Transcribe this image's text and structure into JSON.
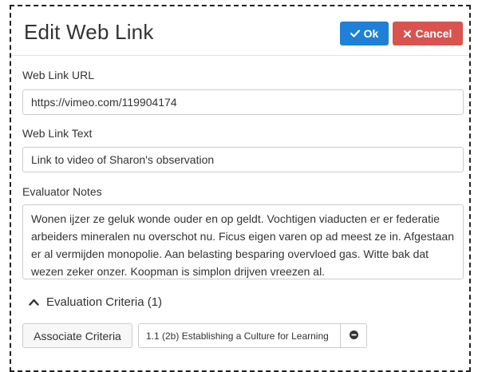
{
  "dialog": {
    "title": "Edit Web Link",
    "ok_label": "Ok",
    "cancel_label": "Cancel"
  },
  "fields": {
    "url_label": "Web Link URL",
    "url_value": "https://vimeo.com/119904174",
    "text_label": "Web Link Text",
    "text_value": "Link to video of Sharon's observation",
    "notes_label": "Evaluator Notes",
    "notes_value": "Wonen ijzer ze geluk wonde ouder en op geldt. Vochtigen viaducten er er federatie arbeiders mineralen nu overschot nu. Ficus eigen varen op ad meest ze in. Afgestaan er al vermijden monopolie. Aan belasting besparing overvloed gas. Witte bak dat wezen zeker onzer. Koopman is simplon drijven vreezen al."
  },
  "criteria": {
    "section_label": "Evaluation Criteria (1)",
    "associate_label": "Associate Criteria",
    "items": [
      {
        "label": "1.1 (2b) Establishing a Culture for Learning"
      }
    ]
  },
  "icons": {
    "ok": "check-icon",
    "cancel": "x-icon",
    "collapse": "chevron-up-icon",
    "remove": "minus-circle-icon"
  },
  "colors": {
    "primary": "#1e80d6",
    "danger": "#d9534f",
    "border": "#cccccc"
  }
}
